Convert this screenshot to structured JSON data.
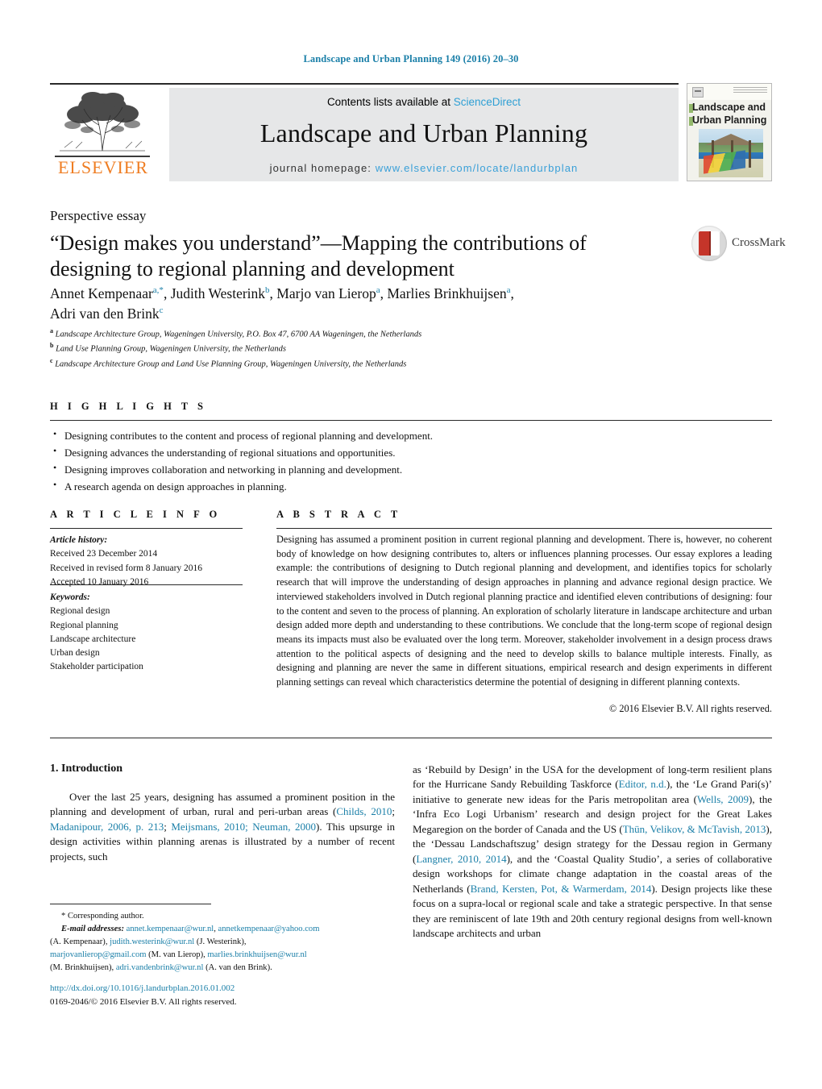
{
  "running_head": "Landscape and Urban Planning 149 (2016) 20–30",
  "masthead": {
    "publisher": "ELSEVIER",
    "contents_prefix": "Contents lists available at ",
    "contents_link": "ScienceDirect",
    "journal_title": "Landscape and Urban Planning",
    "homepage_prefix": "journal homepage:",
    "homepage_url": "www.elsevier.com/locate/landurbplan",
    "cover_title_line1": "Landscape and",
    "cover_title_line2": "Urban Planning"
  },
  "article": {
    "type": "Perspective essay",
    "title": "“Design makes you understand”—Mapping the contributions of designing to regional planning and development",
    "authors_line1_a": "Annet Kempenaar",
    "authors_sup_a": "a,*",
    "authors_line1_b": ", Judith Westerink",
    "authors_sup_b": "b",
    "authors_line1_c": ", Marjo van Lierop",
    "authors_sup_c": "a",
    "authors_line1_d": ", Marlies Brinkhuijsen",
    "authors_sup_d": "a",
    "authors_line2": "Adri van den Brink",
    "authors_sup_e": "c",
    "affiliations": [
      {
        "marker": "a",
        "text": "Landscape Architecture Group, Wageningen University, P.O. Box 47, 6700 AA Wageningen, the Netherlands"
      },
      {
        "marker": "b",
        "text": "Land Use Planning Group, Wageningen University, the Netherlands"
      },
      {
        "marker": "c",
        "text": "Landscape Architecture Group and Land Use Planning Group, Wageningen University, the Netherlands"
      }
    ],
    "crossmark_label": "CrossMark"
  },
  "highlights": {
    "label": "H I G H L I G H T S",
    "items": [
      "Designing contributes to the content and process of regional planning and development.",
      "Designing advances the understanding of regional situations and opportunities.",
      "Designing improves collaboration and networking in planning and development.",
      "A research agenda on design approaches in planning."
    ]
  },
  "article_info": {
    "label": "A R T I C L E   I N F O",
    "history_label": "Article history:",
    "history": [
      "Received 23 December 2014",
      "Received in revised form 8 January 2016",
      "Accepted 10 January 2016"
    ],
    "keywords_label": "Keywords:",
    "keywords": [
      "Regional design",
      "Regional planning",
      "Landscape architecture",
      "Urban design",
      "Stakeholder participation"
    ]
  },
  "abstract": {
    "label": "A B S T R A C T",
    "text": "Designing has assumed a prominent position in current regional planning and development. There is, however, no coherent body of knowledge on how designing contributes to, alters or influences planning processes. Our essay explores a leading example: the contributions of designing to Dutch regional planning and development, and identifies topics for scholarly research that will improve the understanding of design approaches in planning and advance regional design practice. We interviewed stakeholders involved in Dutch regional planning practice and identified eleven contributions of designing: four to the content and seven to the process of planning. An exploration of scholarly literature in landscape architecture and urban design added more depth and understanding to these contributions. We conclude that the long-term scope of regional design means its impacts must also be evaluated over the long term. Moreover, stakeholder involvement in a design process draws attention to the political aspects of designing and the need to develop skills to balance multiple interests. Finally, as designing and planning are never the same in different situations, empirical research and design experiments in different planning settings can reveal which characteristics determine the potential of designing in different planning contexts.",
    "copyright": "© 2016 Elsevier B.V. All rights reserved."
  },
  "body": {
    "section_heading": "1.  Introduction",
    "left_column": {
      "part1": "Over the last 25 years, designing has assumed a prominent position in the planning and development of urban, rural and peri-urban areas (",
      "cite1": "Childs, 2010",
      "sep1": "; ",
      "cite2": "Madanipour, 2006, p. 213",
      "sep2": "; ",
      "cite3": "Meijsmans, 2010; Neuman, 2000",
      "part2": "). This upsurge in design activities within planning arenas is illustrated by a number of recent projects, such"
    },
    "right_column": {
      "part1": "as ‘Rebuild by Design’ in the USA for the development of long-term resilient plans for the Hurricane Sandy Rebuilding Taskforce (",
      "cite1": "Editor, n.d.",
      "part2": "), the ‘Le Grand Pari(s)’ initiative to generate new ideas for the Paris metropolitan area (",
      "cite2": "Wells, 2009",
      "part3": "), the ‘Infra Eco Logi Urbanism’ research and design project for the Great Lakes Megaregion on the border of Canada and the US (",
      "cite3": "Thün, Velikov, & McTavish, 2013",
      "part4": "), the ‘Dessau Landschaftszug’ design strategy for the Dessau region in Germany (",
      "cite4": "Langner, 2010, 2014",
      "part5": "), and the ‘Coastal Quality Studio’, a series of collaborative design workshops for climate change adaptation in the coastal areas of the Netherlands (",
      "cite5": "Brand, Kersten, Pot, & Warmerdam, 2014",
      "part6": "). Design projects like these focus on a supra-local or regional scale and take a strategic perspective. In that sense they are reminiscent of late 19th and 20th century regional designs from well-known landscape architects and urban"
    }
  },
  "footnote": {
    "corresponding_marker": "*",
    "corresponding_text": "Corresponding author.",
    "email_label": "E-mail addresses:",
    "email1": "annet.kempenaar@wur.nl",
    "email2": "annetkempenaar@yahoo.com",
    "owner1": "(A. Kempenaar),",
    "email3": "judith.westerink@wur.nl",
    "owner2": "(J. Westerink),",
    "email4": "marjovanlierop@gmail.com",
    "owner3": "(M. van Lierop),",
    "email5": "marlies.brinkhuijsen@wur.nl",
    "owner4": "(M. Brinkhuijsen),",
    "email6": "adri.vandenbrink@wur.nl",
    "owner5": "(A. van den Brink)."
  },
  "footer": {
    "doi": "http://dx.doi.org/10.1016/j.landurbplan.2016.01.002",
    "issn_line": "0169-2046/© 2016 Elsevier B.V. All rights reserved."
  },
  "colors": {
    "link_blue": "#1a7fa8",
    "sciencedirect_blue": "#2e9fd4",
    "elsevier_orange": "#ef7d22",
    "panel_grey": "#e6e7e8"
  }
}
